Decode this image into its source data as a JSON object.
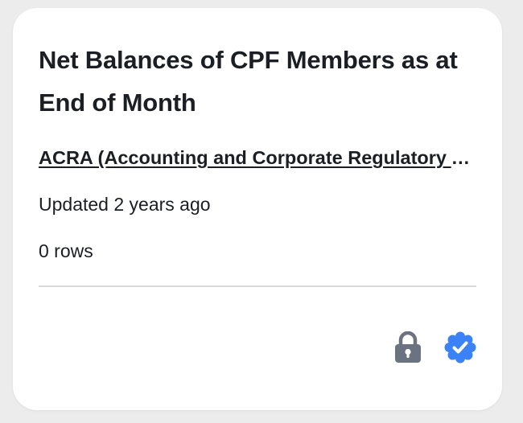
{
  "card": {
    "title": "Net Balances of CPF Members as at End of Month",
    "publisher": "ACRA (Accounting and Corporate Regulatory Authority)",
    "updated": "Updated 2 years ago",
    "rows": "0 rows"
  },
  "icons": {
    "lock": "lock-icon",
    "verified": "verified-badge-icon"
  },
  "colors": {
    "lock": "#6b7280",
    "verified": "#3b82f6",
    "text": "#1b1f24",
    "divider": "#d9d9d9"
  }
}
